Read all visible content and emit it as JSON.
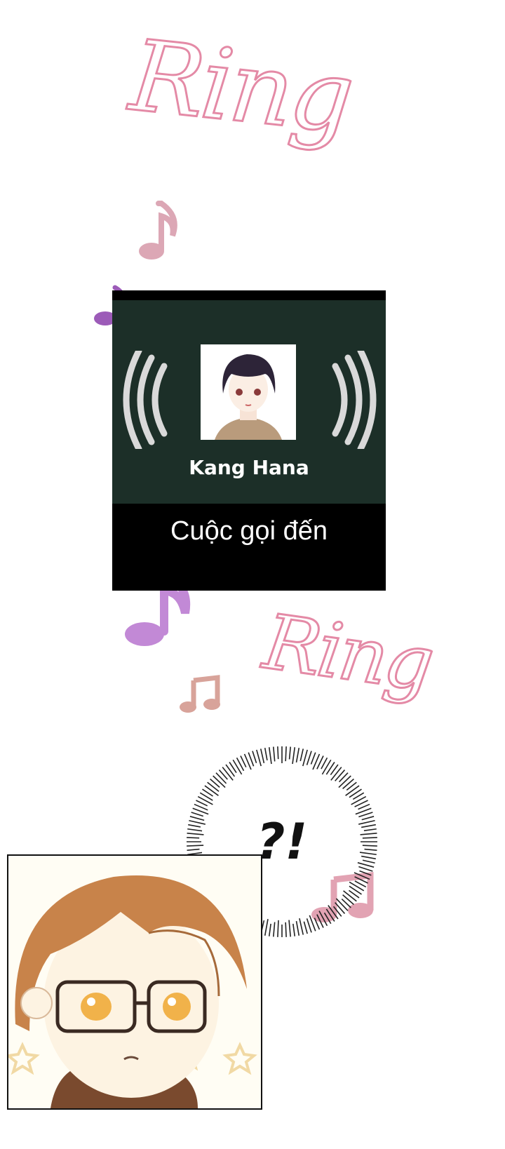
{
  "sfx": {
    "ring_top": "Ring",
    "ring_bottom": "Ring"
  },
  "call": {
    "caller_name": "Kang Hana",
    "status": "Cuộc gọi đến",
    "icons": [
      "signal-waves-left-icon",
      "signal-waves-right-icon"
    ]
  },
  "reaction": {
    "text": "?!"
  },
  "colors": {
    "screen_bg": "#1c2f28",
    "bar_bg": "#000000",
    "ring_outline": "#e48aa6",
    "note_pink": "#dca7b5",
    "note_purple": "#9c5bb8",
    "note_violet": "#c289d6",
    "note_tan": "#d8a39a"
  }
}
